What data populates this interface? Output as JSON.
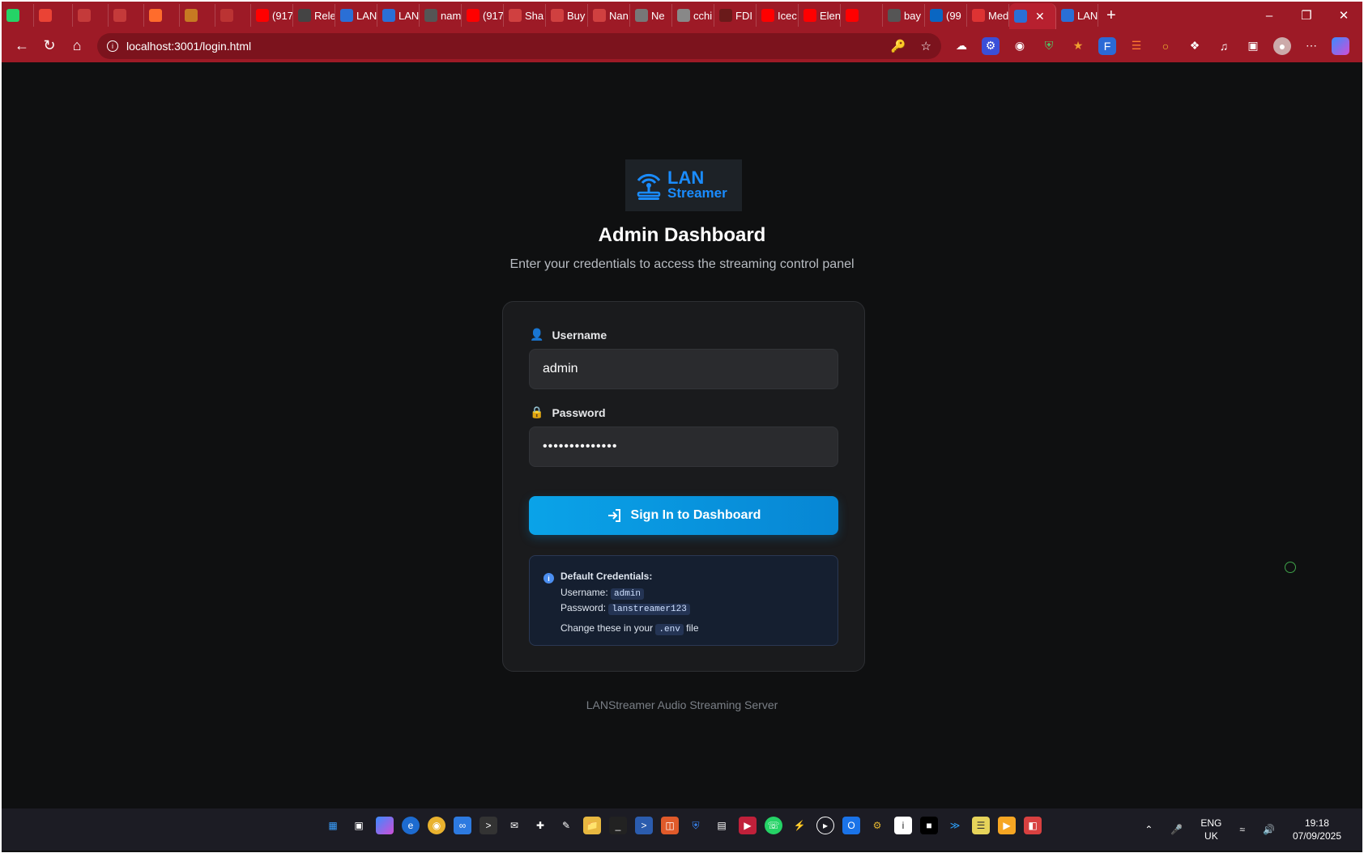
{
  "browser": {
    "tabs": [
      {
        "title": "",
        "icon": "whatsapp-icon",
        "color": "#25d366"
      },
      {
        "title": "",
        "icon": "gmail-icon",
        "color": "#ea4335"
      },
      {
        "title": "",
        "icon": "gmail-icon",
        "color": "#c43a3a"
      },
      {
        "title": "",
        "icon": "gmail-icon",
        "color": "#c43a3a"
      },
      {
        "title": "",
        "icon": "cpanel-icon",
        "color": "#ff6c2c"
      },
      {
        "title": "",
        "icon": "app-icon",
        "color": "#c77a22"
      },
      {
        "title": "",
        "icon": "app-icon",
        "color": "#b33"
      },
      {
        "title": "(917",
        "icon": "youtube-icon",
        "color": "#ff0000"
      },
      {
        "title": "Rele",
        "icon": "github-icon",
        "color": "#444"
      },
      {
        "title": "LAN",
        "icon": "lanstreamer-icon",
        "color": "#2a6fd6"
      },
      {
        "title": "LAN",
        "icon": "lanstreamer-icon",
        "color": "#2a6fd6"
      },
      {
        "title": "nam",
        "icon": "search-icon",
        "color": "#555"
      },
      {
        "title": "(917",
        "icon": "youtube-icon",
        "color": "#ff0000"
      },
      {
        "title": "Sha",
        "icon": "app-icon",
        "color": "#d04040"
      },
      {
        "title": "Buy",
        "icon": "app-icon",
        "color": "#d04040"
      },
      {
        "title": "Nan",
        "icon": "app-icon",
        "color": "#d04040"
      },
      {
        "title": "Ne",
        "icon": "wikipedia-icon",
        "color": "#777"
      },
      {
        "title": "cchi",
        "icon": "app-icon",
        "color": "#888"
      },
      {
        "title": "FDI",
        "icon": "app-icon",
        "color": "#6a1a1a"
      },
      {
        "title": "Icec",
        "icon": "youtube-icon",
        "color": "#ff0000"
      },
      {
        "title": "Elen",
        "icon": "youtube-icon",
        "color": "#ff0000"
      },
      {
        "title": "",
        "icon": "youtube-icon",
        "color": "#ff0000"
      },
      {
        "title": "bay",
        "icon": "search-icon",
        "color": "#555"
      },
      {
        "title": "(99",
        "icon": "linkedin-icon",
        "color": "#0a66c2"
      },
      {
        "title": "Med",
        "icon": "pdf-icon",
        "color": "#d33"
      },
      {
        "title": "",
        "icon": "lanstreamer-icon",
        "color": "#2a6fd6",
        "active": true
      },
      {
        "title": "LAN",
        "icon": "lanstreamer-icon",
        "color": "#2a6fd6"
      }
    ],
    "url": "localhost:3001/login.html"
  },
  "page": {
    "logo_line1": "LAN",
    "logo_line2": "Streamer",
    "title": "Admin Dashboard",
    "subtitle": "Enter your credentials to access the streaming control panel",
    "username_label": "Username",
    "username_value": "admin",
    "password_label": "Password",
    "password_value": "••••••••••••••",
    "submit_label": "Sign In to Dashboard",
    "note_heading": "Default Credentials:",
    "note_username_prefix": "Username:",
    "note_username": "admin",
    "note_password_prefix": "Password:",
    "note_password": "lanstreamer123",
    "note_change_prefix": "Change these in your",
    "note_change_file": ".env",
    "note_change_suffix": "file",
    "footer": "LANStreamer Audio Streaming Server"
  },
  "taskbar": {
    "language_line1": "ENG",
    "language_line2": "UK",
    "time": "19:18",
    "date": "07/09/2025"
  },
  "colors": {
    "chrome": "#9d1a26",
    "accent": "#0aa3e8",
    "logo": "#1a8cff"
  }
}
